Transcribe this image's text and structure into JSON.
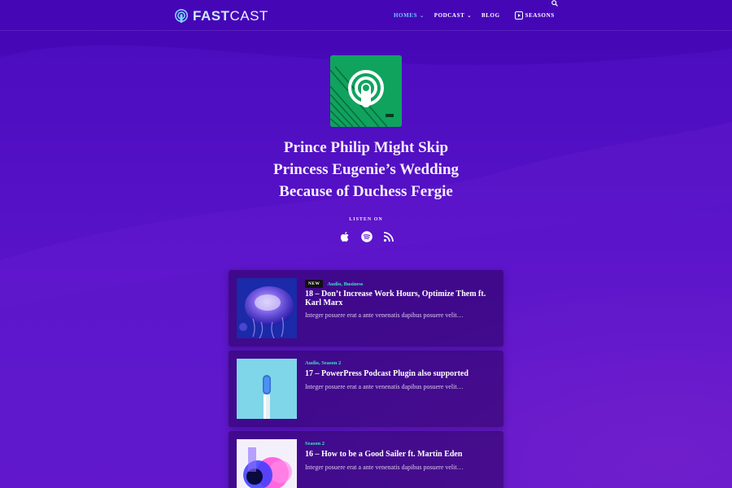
{
  "brand": {
    "name_bold": "FAST",
    "name_light": "CAST"
  },
  "nav": {
    "items": [
      {
        "label": "HOMES",
        "active": true,
        "has_menu": true
      },
      {
        "label": "PODCAST",
        "active": false,
        "has_menu": true
      },
      {
        "label": "BLOG",
        "active": false,
        "has_menu": false
      }
    ],
    "seasons_label": "SEASONS",
    "caret": "⌄"
  },
  "hero": {
    "title_lines": [
      "Prince Philip Might Skip",
      "Princess Eugenie’s Wedding",
      "Because of Duchess Fergie"
    ],
    "listen_label": "LISTEN ON",
    "platforms": [
      "apple-icon",
      "spotify-icon",
      "rss-icon"
    ]
  },
  "episodes": [
    {
      "badge": "NEW",
      "categories": "Audio, Business",
      "title": "18 – Don’t Increase Work Hours, Optimize Them ft. Karl Marx",
      "excerpt": "Integer posuere erat a ante venenatis dapibus posuere velit…"
    },
    {
      "badge": "",
      "categories": "Audio, Season 2",
      "title": "17 – PowerPress Podcast Plugin also supported",
      "excerpt": "Integer posuere erat a ante venenatis dapibus posuere velit…"
    },
    {
      "badge": "",
      "categories": "Season 2",
      "title": "16 – How to be a Good Sailer ft. Martin Eden",
      "excerpt": "Integer posuere erat a ante venenatis dapibus posuere velit…"
    }
  ],
  "colors": {
    "background": "#5a10c8",
    "accent": "#6ecbff",
    "category": "#3fe0c8",
    "card": "#2a0460"
  }
}
